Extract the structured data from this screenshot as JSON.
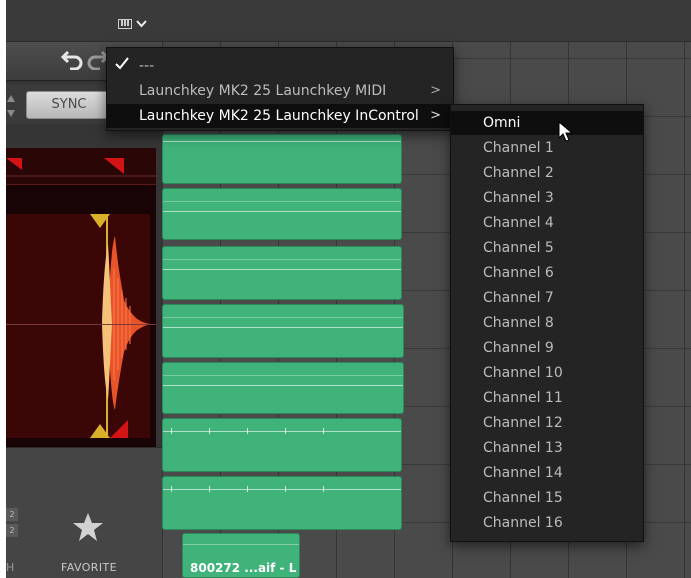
{
  "toolbar": {
    "midi_chevron": "⌄"
  },
  "left_panel": {
    "sync_label": "SYNC",
    "favorite_label": "FAVORITE",
    "side_label": "H",
    "badges": [
      "2",
      "2"
    ]
  },
  "regions": {
    "bottom_region_label": "800272 ...aif - L"
  },
  "device_menu": {
    "items": [
      {
        "label": "---",
        "checked": true,
        "submenu": false
      },
      {
        "label": "Launchkey MK2 25 Launchkey MIDI",
        "checked": false,
        "submenu": true
      },
      {
        "label": "Launchkey MK2 25 Launchkey InControl",
        "checked": false,
        "submenu": true,
        "highlighted": true
      }
    ],
    "submenu_arrow": ">"
  },
  "channel_menu": {
    "items": [
      "Omni",
      "Channel 1",
      "Channel 2",
      "Channel 3",
      "Channel 4",
      "Channel 5",
      "Channel 6",
      "Channel 7",
      "Channel 8",
      "Channel 9",
      "Channel 10",
      "Channel 11",
      "Channel 12",
      "Channel 13",
      "Channel 14",
      "Channel 15",
      "Channel 16"
    ],
    "highlighted_index": 0
  },
  "colors": {
    "region_green": "#3fb37a",
    "menu_bg": "#242424",
    "waveform_orange": "#e8542a"
  }
}
